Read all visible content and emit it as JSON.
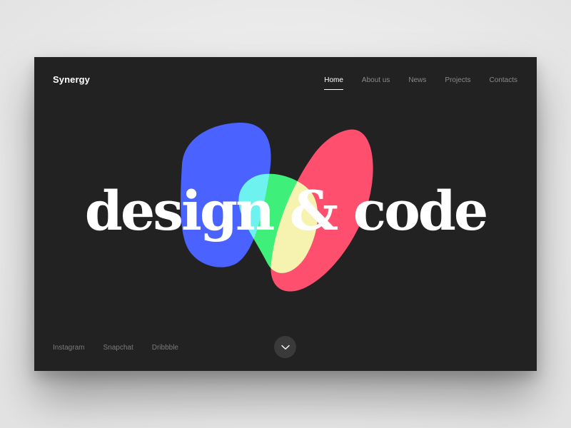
{
  "brand": {
    "name": "Synergy"
  },
  "nav": {
    "items": [
      {
        "label": "Home",
        "active": true
      },
      {
        "label": "About us",
        "active": false
      },
      {
        "label": "News",
        "active": false
      },
      {
        "label": "Projects",
        "active": false
      },
      {
        "label": "Contacts",
        "active": false
      }
    ]
  },
  "hero": {
    "headline": "design & code"
  },
  "social": {
    "items": [
      {
        "label": "Instagram"
      },
      {
        "label": "Snapchat"
      },
      {
        "label": "Dribbble"
      }
    ]
  },
  "scroll_button": {
    "icon": "chevron-down-icon"
  },
  "colors": {
    "background": "#222222",
    "blob_blue": "#4a62ff",
    "blob_red": "#ff4f6e",
    "blob_green": "#3ef07a",
    "blob_cyan": "#6ef2f0",
    "blob_yellow": "#f6f3b0"
  }
}
